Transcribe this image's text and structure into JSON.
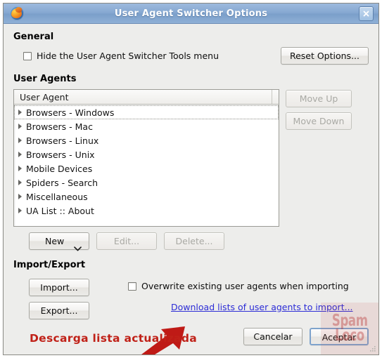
{
  "window": {
    "title": "User Agent Switcher Options",
    "app_icon": "firefox-icon",
    "close_icon": "close-icon"
  },
  "general": {
    "heading": "General",
    "hide_menu_checkbox_label": "Hide the User Agent Switcher Tools menu",
    "hide_menu_checked": false,
    "reset_button": "Reset Options..."
  },
  "user_agents": {
    "heading": "User Agents",
    "column_header": "User Agent",
    "items": [
      {
        "label": "Browsers - Windows",
        "expanded": false,
        "focused": true
      },
      {
        "label": "Browsers - Mac",
        "expanded": false,
        "focused": false
      },
      {
        "label": "Browsers - Linux",
        "expanded": false,
        "focused": false
      },
      {
        "label": "Browsers - Unix",
        "expanded": false,
        "focused": false
      },
      {
        "label": "Mobile Devices",
        "expanded": false,
        "focused": false
      },
      {
        "label": "Spiders - Search",
        "expanded": false,
        "focused": false
      },
      {
        "label": "Miscellaneous",
        "expanded": false,
        "focused": false
      },
      {
        "label": "UA List :: About",
        "expanded": false,
        "focused": false
      }
    ],
    "move_up_button": "Move Up",
    "move_down_button": "Move Down",
    "new_button": "New",
    "edit_button": "Edit...",
    "delete_button": "Delete..."
  },
  "import_export": {
    "heading": "Import/Export",
    "import_button": "Import...",
    "export_button": "Export...",
    "overwrite_checkbox_label": "Overwrite existing user agents when importing",
    "overwrite_checked": false,
    "download_link": "Download lists of user agents to import..."
  },
  "footer": {
    "cancel_button": "Cancelar",
    "accept_button": "Aceptar"
  },
  "annotation": {
    "text": "Descarga lista actualizada",
    "arrow_icon": "red-arrow-icon",
    "color": "#c02118"
  },
  "watermark": {
    "line1": "Spam",
    "line2": "Loco"
  }
}
